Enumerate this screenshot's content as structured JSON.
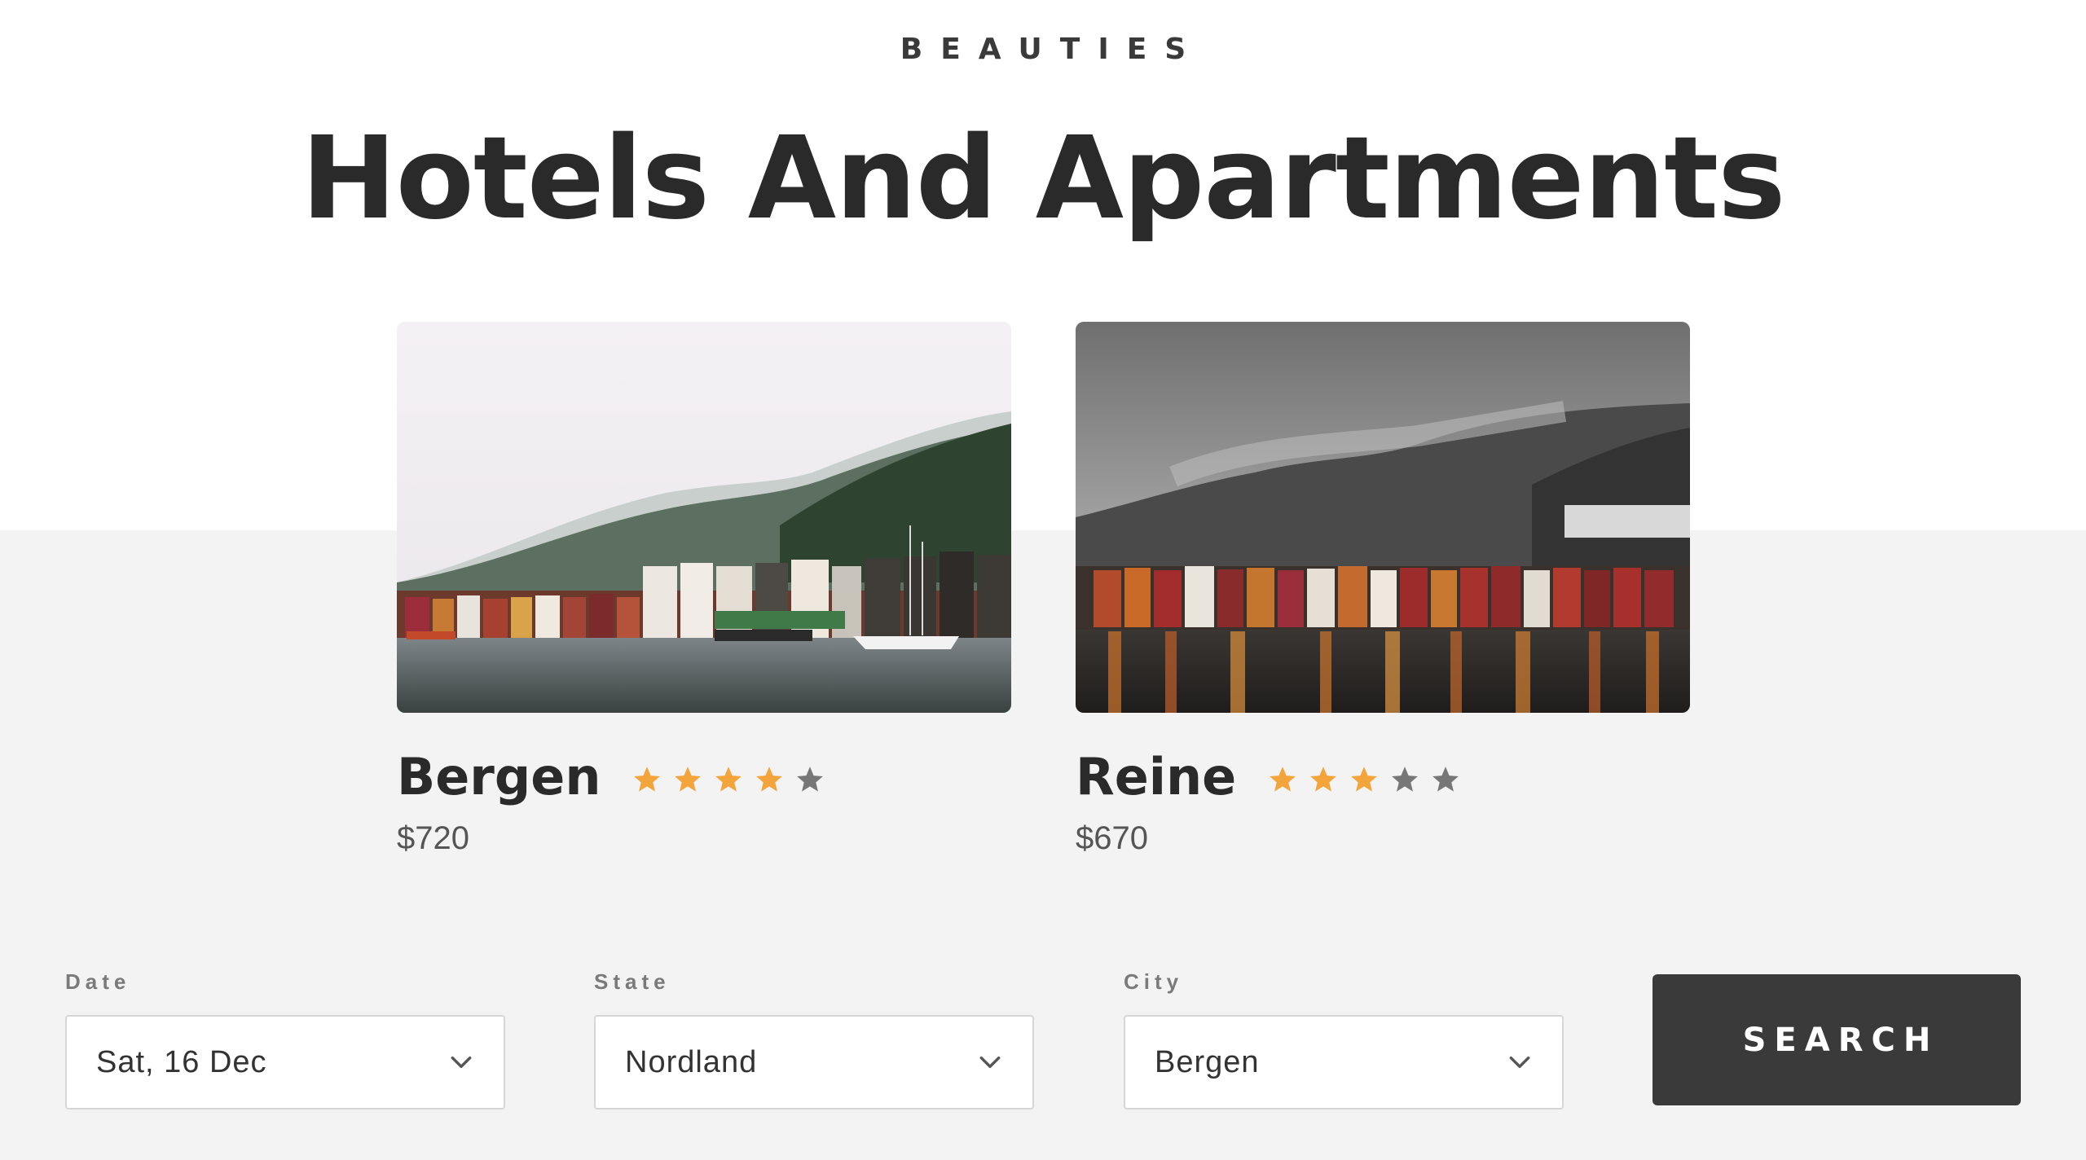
{
  "header": {
    "eyebrow": "BEAUTIES",
    "title": "Hotels And Apartments"
  },
  "cards": [
    {
      "name": "Bergen",
      "price": "$720",
      "rating": 4,
      "max_rating": 5
    },
    {
      "name": "Reine",
      "price": "$670",
      "rating": 3,
      "max_rating": 5
    }
  ],
  "search": {
    "date": {
      "label": "Date",
      "value": "Sat, 16 Dec"
    },
    "state": {
      "label": "State",
      "value": "Nordland"
    },
    "city": {
      "label": "City",
      "value": "Bergen"
    },
    "button_label": "SEARCH"
  },
  "colors": {
    "star_filled": "#f3a43a",
    "star_empty": "#777777",
    "button_bg": "#3a3a3a"
  }
}
